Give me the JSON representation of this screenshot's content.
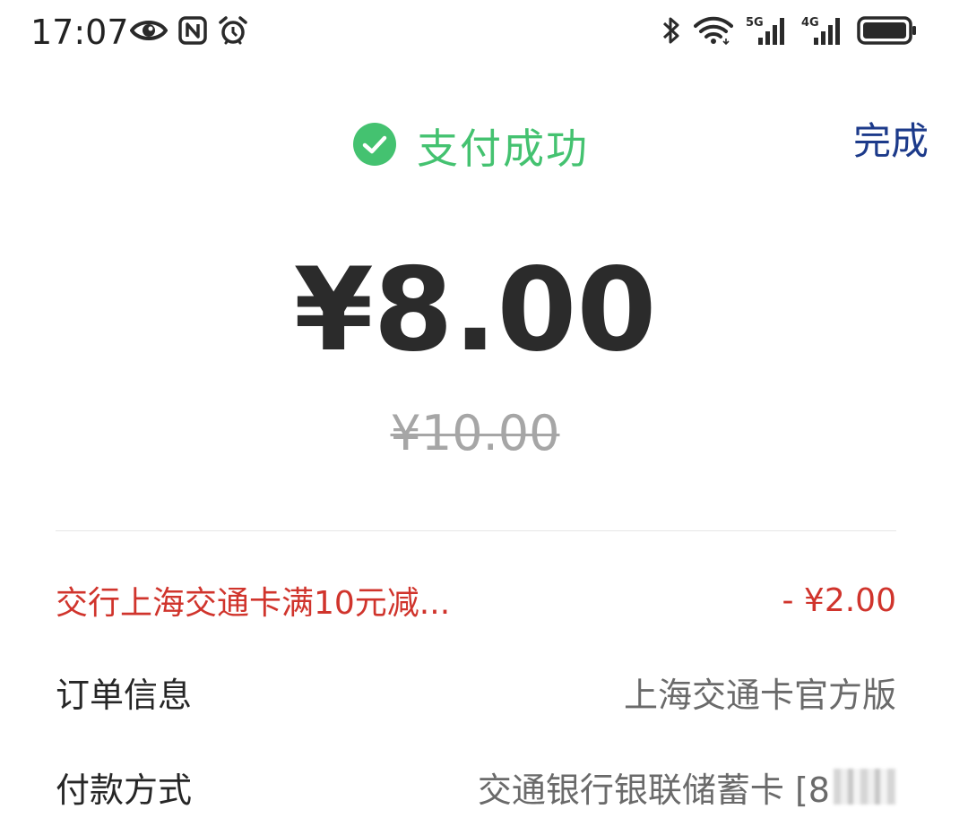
{
  "status_bar": {
    "time": "17:07",
    "icons_left": [
      "eye-icon",
      "nfc-icon",
      "alarm-icon"
    ],
    "icons_right": [
      "bluetooth-icon",
      "wifi-icon",
      "signal-5g-icon",
      "signal-4g-icon",
      "battery-icon"
    ],
    "signal_5g_label": "5G",
    "signal_4g_label": "4G"
  },
  "header": {
    "title": "支付成功",
    "done_label": "完成",
    "success_color": "#44c270",
    "done_color": "#1c3a8a"
  },
  "payment": {
    "amount": "¥8.00",
    "original_amount": "¥10.00"
  },
  "discount": {
    "label": "交行上海交通卡满10元减...",
    "value": "- ¥2.00",
    "color": "#d0342c"
  },
  "order": {
    "label": "订单信息",
    "value": "上海交通卡官方版"
  },
  "payment_method": {
    "label": "付款方式",
    "value": "交通银行银联储蓄卡 [8"
  }
}
